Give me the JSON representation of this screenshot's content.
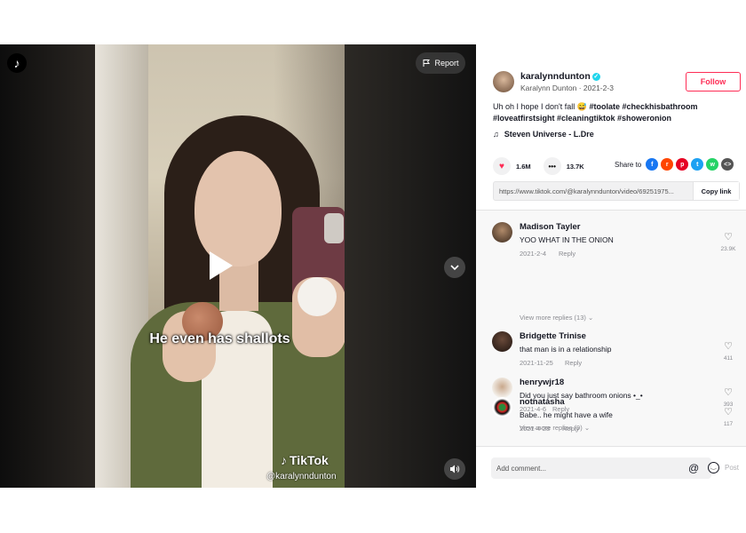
{
  "video": {
    "caption": "He even has shallots",
    "watermark": "TikTok",
    "watermark_user": "@karalynndunton",
    "report_label": "Report"
  },
  "author": {
    "username": "karalynndunton",
    "display_name": "Karalynn Dunton",
    "date": "2021-2-3",
    "follow_label": "Follow"
  },
  "description": {
    "text": "Uh oh I hope I don't fall 😅",
    "tags_line1": "#toolate #checkhisbathroom",
    "tags_line2": "#loveatfirstsight #cleaningtiktok #showeronion"
  },
  "music": "Steven Universe - L.Dre",
  "stats": {
    "likes": "1.6M",
    "comments": "13.7K",
    "share_label": "Share to"
  },
  "share_icons": [
    "facebook-icon",
    "reddit-icon",
    "pinterest-icon",
    "twitter-icon",
    "whatsapp-icon",
    "embed-icon"
  ],
  "link": {
    "url": "https://www.tiktok.com/@karalynndunton/video/69251975...",
    "copy_label": "Copy link"
  },
  "comments": [
    {
      "name": "Madison Tayler",
      "text": "YOO WHAT IN THE ONION",
      "date": "2021-2-4",
      "reply": "Reply",
      "likes": "23.9K",
      "more": "View more replies (13)"
    },
    {
      "name": "Bridgette Trinise",
      "text": "that man is in a relationship",
      "date": "2021-11-25",
      "reply": "Reply",
      "likes": "411"
    },
    {
      "name": "henrywjr18",
      "text": "Did you just say bathroom onions •_•",
      "date": "2021-4-6",
      "reply": "Reply",
      "likes": "393",
      "more": "View more replies (9)"
    },
    {
      "name": "notnatasha",
      "text": "Babe.. he might have a wife",
      "date": "2021-4-28",
      "reply": "Reply",
      "likes": "117"
    }
  ],
  "add_comment": {
    "placeholder": "Add comment...",
    "post_label": "Post"
  },
  "colors": {
    "accent": "#fe2c55",
    "verified": "#20d5ec"
  }
}
